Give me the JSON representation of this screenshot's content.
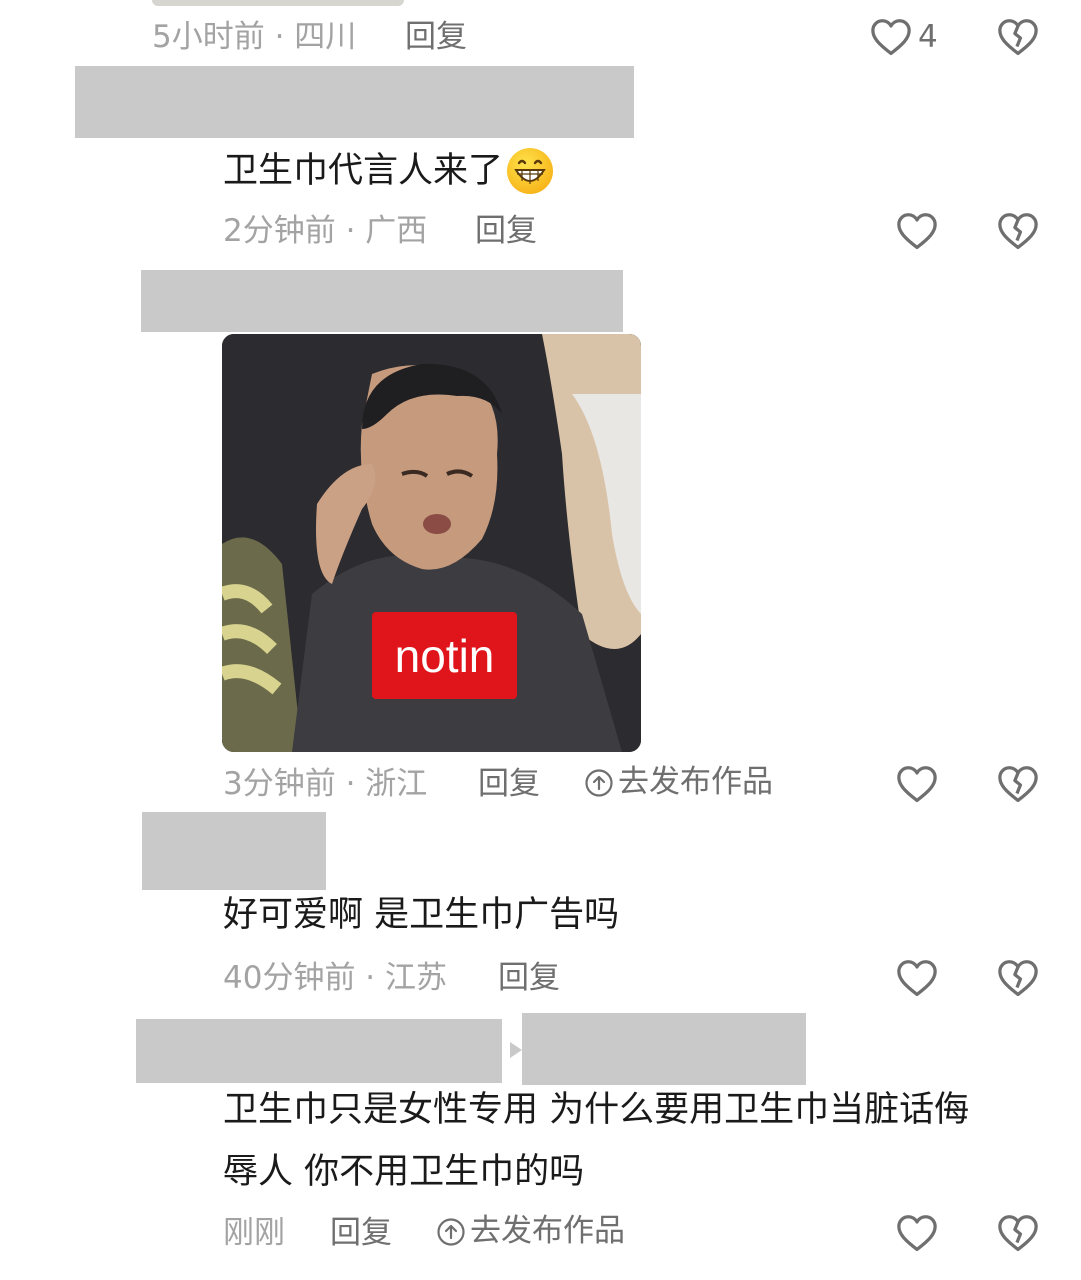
{
  "comments": [
    {
      "time": "5小时前 · 四川",
      "reply_label": "回复",
      "like_count": "4",
      "like_icon": "heart-outline-icon",
      "dislike_icon": "broken-heart-icon"
    },
    {
      "text": "卫生巾代言人来了",
      "emoji": "grinning-face-emoji",
      "time": "2分钟前 · 广西",
      "reply_label": "回复",
      "like_icon": "heart-outline-icon",
      "dislike_icon": "broken-heart-icon"
    },
    {
      "sticker_label": "notin",
      "time": "3分钟前 · 浙江",
      "reply_label": "回复",
      "publish_label": "去发布作品",
      "publish_icon": "upload-circle-icon",
      "like_icon": "heart-outline-icon",
      "dislike_icon": "broken-heart-icon"
    },
    {
      "text": "好可爱啊 是卫生巾广告吗",
      "time": "40分钟前 · 江苏",
      "reply_label": "回复",
      "like_icon": "heart-outline-icon",
      "dislike_icon": "broken-heart-icon"
    },
    {
      "text_line1": "卫生巾只是女性专用 为什么要用卫生巾当脏话侮",
      "text_line2": "辱人 你不用卫生巾的吗",
      "time": "刚刚",
      "reply_label": "回复",
      "publish_label": "去发布作品",
      "publish_icon": "upload-circle-icon",
      "like_icon": "heart-outline-icon",
      "dislike_icon": "broken-heart-icon"
    }
  ],
  "colors": {
    "background": "#ffffff",
    "text": "#1a1a1a",
    "meta_text": "#a3a3a3",
    "action_text": "#6f6f6f",
    "redaction": "#c9c9c9",
    "sticker_label_bg": "#e0151b"
  }
}
